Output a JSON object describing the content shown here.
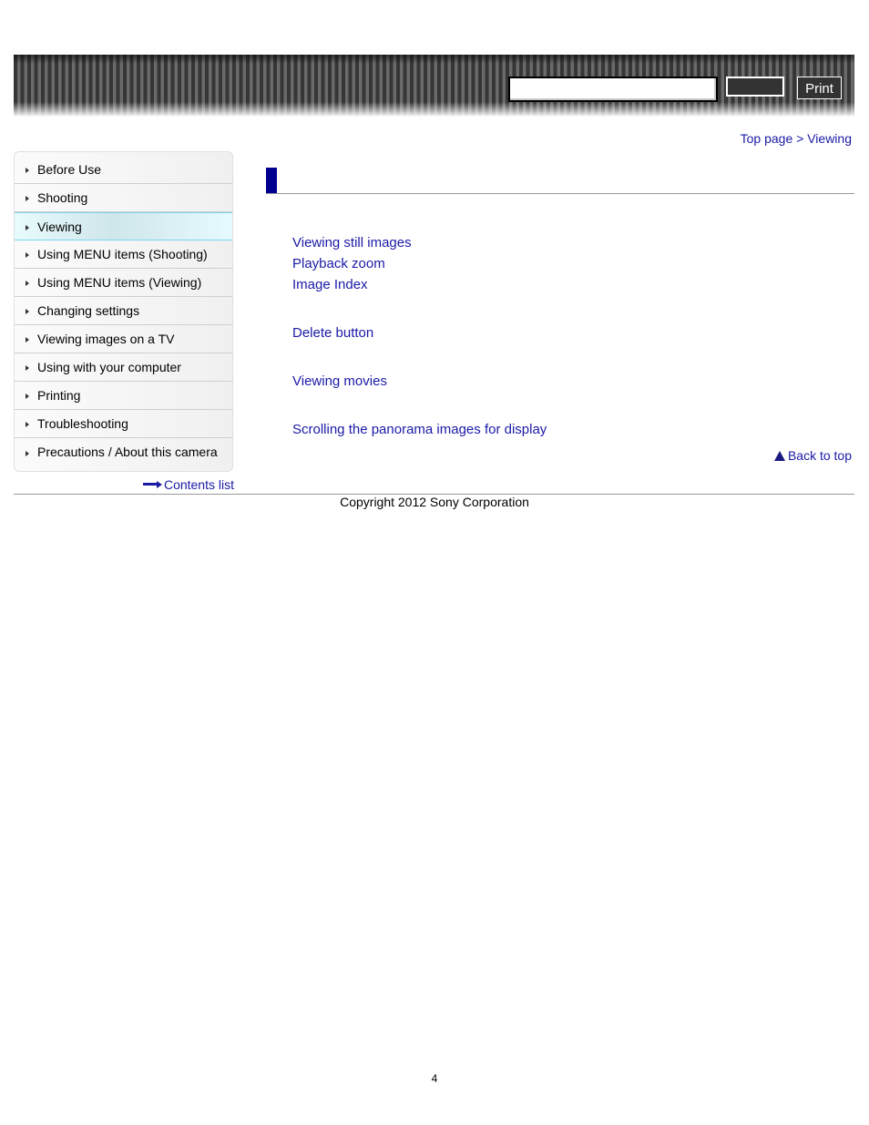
{
  "header": {
    "search_placeholder": "",
    "search_button_label": "",
    "print_label": "Print"
  },
  "breadcrumb": {
    "top_page": "Top page",
    "separator": " > ",
    "current": "Viewing"
  },
  "sidebar": {
    "items": [
      {
        "label": "Before Use",
        "active": false
      },
      {
        "label": "Shooting",
        "active": false
      },
      {
        "label": "Viewing",
        "active": true
      },
      {
        "label": "Using MENU items (Shooting)",
        "active": false
      },
      {
        "label": "Using MENU items (Viewing)",
        "active": false
      },
      {
        "label": "Changing settings",
        "active": false
      },
      {
        "label": "Viewing images on a TV",
        "active": false
      },
      {
        "label": "Using with your computer",
        "active": false
      },
      {
        "label": "Printing",
        "active": false
      },
      {
        "label": "Troubleshooting",
        "active": false
      },
      {
        "label": "Precautions / About this camera",
        "active": false
      }
    ],
    "contents_list": "Contents list"
  },
  "main": {
    "links": [
      "Viewing still images",
      "Playback zoom",
      "Image Index",
      "Delete button",
      "Viewing movies",
      "Scrolling the panorama images for display"
    ],
    "back_to_top": "Back to top"
  },
  "footer": {
    "copyright": "Copyright 2012 Sony Corporation",
    "page_number": "4"
  },
  "colors": {
    "link": "#1a1aa6",
    "title_bar": "#000090",
    "active_item_border": "#7fd3ee"
  }
}
